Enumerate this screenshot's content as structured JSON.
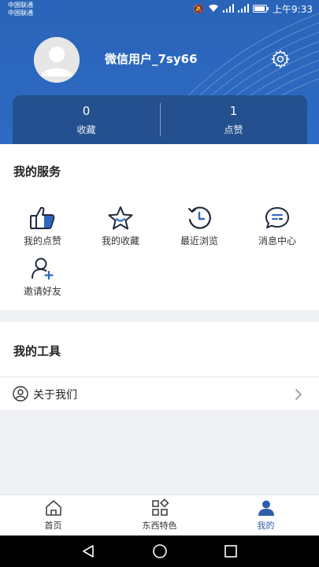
{
  "status_bar": {
    "carrier_1": "中国联通",
    "carrier_2": "中国联通",
    "time": "上午9:33"
  },
  "profile": {
    "username": "微信用户_7sy66",
    "settings_icon": "gear-icon"
  },
  "stats": [
    {
      "value": "0",
      "label": "收藏"
    },
    {
      "value": "1",
      "label": "点赞"
    }
  ],
  "services": {
    "title": "我的服务",
    "items": [
      {
        "label": "我的点赞",
        "icon": "thumbs-up-icon"
      },
      {
        "label": "我的收藏",
        "icon": "star-icon"
      },
      {
        "label": "最近浏览",
        "icon": "history-clock-icon"
      },
      {
        "label": "消息中心",
        "icon": "message-icon"
      },
      {
        "label": "邀请好友",
        "icon": "add-user-icon"
      }
    ]
  },
  "tools": {
    "title": "我的工具",
    "items": [
      {
        "label": "关于我们",
        "icon": "user-circle-icon"
      }
    ]
  },
  "tabs": [
    {
      "label": "首页",
      "icon": "home-icon",
      "active": false
    },
    {
      "label": "东西特色",
      "icon": "grid-icon",
      "active": false
    },
    {
      "label": "我的",
      "icon": "person-icon",
      "active": true
    }
  ],
  "colors": {
    "header_bg": "#2d6bc4",
    "stats_bg": "#24508f",
    "accent": "#2d5fa8",
    "icon_blue": "#2f67c0"
  }
}
